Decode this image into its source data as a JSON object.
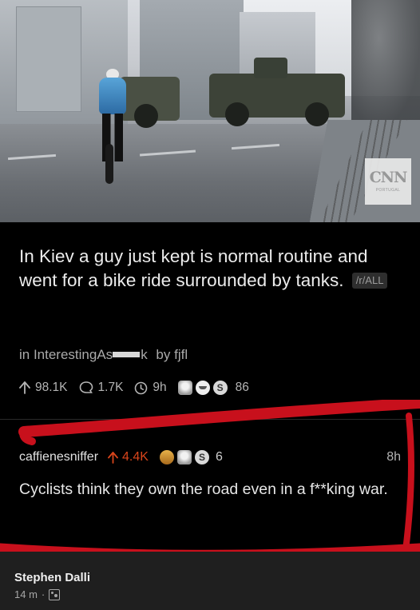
{
  "photo": {
    "watermark_logo": "CNN",
    "watermark_sub": "PORTUGAL"
  },
  "post": {
    "title": "In Kiev a guy just kept is normal routine and went for a bike ride surrounded by tanks.",
    "flair": "/r/ALL",
    "subreddit_prefix": "in InterestingAs",
    "subreddit_suffix": "k",
    "author_text": "by fjfl",
    "upvotes": "98.1K",
    "comments": "1.7K",
    "age": "9h",
    "award_count": "86"
  },
  "comment": {
    "username": "caffienesniffer",
    "upvotes": "4.4K",
    "award_count": "6",
    "time": "8h",
    "body": "Cyclists think they own the road even in a f**king war."
  },
  "footer": {
    "poster_name": "Stephen Dalli",
    "time": "14 m",
    "separator": "·",
    "privacy_icon": "friends-icon"
  },
  "colors": {
    "background": "#000000",
    "upvote_orange": "#d9451b",
    "marker_red": "#c8101c",
    "footer_bg": "#1f1f1f"
  }
}
